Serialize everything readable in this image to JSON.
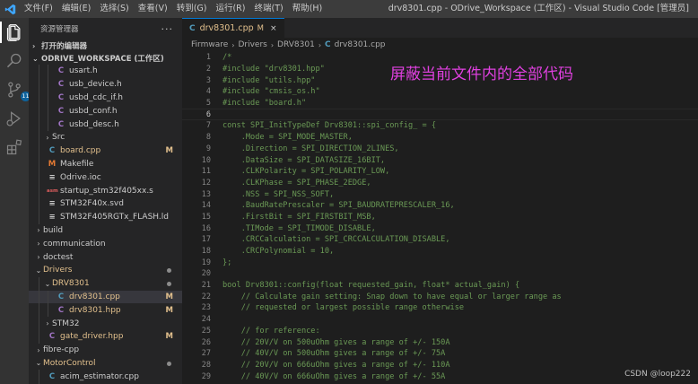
{
  "titlebar": {
    "menus": [
      "文件(F)",
      "编辑(E)",
      "选择(S)",
      "查看(V)",
      "转到(G)",
      "运行(R)",
      "终端(T)",
      "帮助(H)"
    ],
    "window_title": "drv8301.cpp - ODrive_Workspace (工作区) - Visual Studio Code [管理员]"
  },
  "activity": {
    "scm_badge": "11"
  },
  "sidebar": {
    "title": "资源管理器",
    "more": "···",
    "open_editors": "打开的编辑器",
    "workspace": "ODRIVE_WORKSPACE (工作区)",
    "items": [
      {
        "label": "usart.h",
        "icon": "C",
        "type": "h",
        "depth": 2
      },
      {
        "label": "usb_device.h",
        "icon": "C",
        "type": "h",
        "depth": 2
      },
      {
        "label": "usbd_cdc_if.h",
        "icon": "C",
        "type": "h",
        "depth": 2
      },
      {
        "label": "usbd_conf.h",
        "icon": "C",
        "type": "h",
        "depth": 2
      },
      {
        "label": "usbd_desc.h",
        "icon": "C",
        "type": "h",
        "depth": 2
      },
      {
        "label": "Src",
        "folder": true,
        "depth": 1
      },
      {
        "label": "board.cpp",
        "icon": "C",
        "type": "cpp",
        "depth": 1,
        "status": "M"
      },
      {
        "label": "Makefile",
        "icon": "M",
        "type": "make",
        "depth": 1
      },
      {
        "label": "Odrive.ioc",
        "icon": "≡",
        "type": "txt",
        "depth": 1
      },
      {
        "label": "startup_stm32f405xx.s",
        "icon": "asm",
        "type": "asm",
        "depth": 1
      },
      {
        "label": "STM32F40x.svd",
        "icon": "≡",
        "type": "txt",
        "depth": 1
      },
      {
        "label": "STM32F405RGTx_FLASH.ld",
        "icon": "≡",
        "type": "txt",
        "depth": 1
      },
      {
        "label": "build",
        "folder": true,
        "depth": 0
      },
      {
        "label": "communication",
        "folder": true,
        "depth": 0
      },
      {
        "label": "doctest",
        "folder": true,
        "depth": 0
      },
      {
        "label": "Drivers",
        "folder": true,
        "open": true,
        "depth": 0,
        "dot": true
      },
      {
        "label": "DRV8301",
        "folder": true,
        "open": true,
        "depth": 1,
        "dot": true
      },
      {
        "label": "drv8301.cpp",
        "icon": "C",
        "type": "cpp",
        "depth": 2,
        "status": "M",
        "selected": true
      },
      {
        "label": "drv8301.hpp",
        "icon": "C",
        "type": "h",
        "depth": 2,
        "status": "M"
      },
      {
        "label": "STM32",
        "folder": true,
        "depth": 1
      },
      {
        "label": "gate_driver.hpp",
        "icon": "C",
        "type": "h",
        "depth": 1,
        "status": "M"
      },
      {
        "label": "fibre-cpp",
        "folder": true,
        "depth": 0
      },
      {
        "label": "MotorControl",
        "folder": true,
        "open": true,
        "depth": 0,
        "dot": true
      },
      {
        "label": "acim_estimator.cpp",
        "icon": "C",
        "type": "cpp",
        "depth": 1
      },
      {
        "label": "acim_estimator.hpp",
        "icon": "C",
        "type": "h",
        "depth": 1
      }
    ]
  },
  "editor": {
    "tab": {
      "label": "drv8301.cpp",
      "modified": "M",
      "close": "×",
      "icon": "C"
    },
    "breadcrumb": [
      "Firmware",
      "Drivers",
      "DRV8301",
      "drv8301.cpp"
    ],
    "active_line": 6,
    "lines": [
      {
        "n": 1,
        "text": "/*"
      },
      {
        "n": 2,
        "text": "#include \"drv8301.hpp\""
      },
      {
        "n": 3,
        "text": "#include \"utils.hpp\""
      },
      {
        "n": 4,
        "text": "#include \"cmsis_os.h\""
      },
      {
        "n": 5,
        "text": "#include \"board.h\""
      },
      {
        "n": 6,
        "text": ""
      },
      {
        "n": 7,
        "text": "const SPI_InitTypeDef Drv8301::spi_config_ = {"
      },
      {
        "n": 8,
        "text": "    .Mode = SPI_MODE_MASTER,"
      },
      {
        "n": 9,
        "text": "    .Direction = SPI_DIRECTION_2LINES,"
      },
      {
        "n": 10,
        "text": "    .DataSize = SPI_DATASIZE_16BIT,"
      },
      {
        "n": 11,
        "text": "    .CLKPolarity = SPI_POLARITY_LOW,"
      },
      {
        "n": 12,
        "text": "    .CLKPhase = SPI_PHASE_2EDGE,"
      },
      {
        "n": 13,
        "text": "    .NSS = SPI_NSS_SOFT,"
      },
      {
        "n": 14,
        "text": "    .BaudRatePrescaler = SPI_BAUDRATEPRESCALER_16,"
      },
      {
        "n": 15,
        "text": "    .FirstBit = SPI_FIRSTBIT_MSB,"
      },
      {
        "n": 16,
        "text": "    .TIMode = SPI_TIMODE_DISABLE,"
      },
      {
        "n": 17,
        "text": "    .CRCCalculation = SPI_CRCCALCULATION_DISABLE,"
      },
      {
        "n": 18,
        "text": "    .CRCPolynomial = 10,"
      },
      {
        "n": 19,
        "text": "};"
      },
      {
        "n": 20,
        "text": ""
      },
      {
        "n": 21,
        "text": "bool Drv8301::config(float requested_gain, float* actual_gain) {"
      },
      {
        "n": 22,
        "text": "    // Calculate gain setting: Snap down to have equal or larger range as"
      },
      {
        "n": 23,
        "text": "    // requested or largest possible range otherwise"
      },
      {
        "n": 24,
        "text": ""
      },
      {
        "n": 25,
        "text": "    // for reference:"
      },
      {
        "n": 26,
        "text": "    // 20V/V on 500uOhm gives a range of +/- 150A"
      },
      {
        "n": 27,
        "text": "    // 40V/V on 500uOhm gives a range of +/- 75A"
      },
      {
        "n": 28,
        "text": "    // 20V/V on 666uOhm gives a range of +/- 110A"
      },
      {
        "n": 29,
        "text": "    // 40V/V on 666uOhm gives a range of +/- 55A"
      }
    ]
  },
  "annotation": "屏蔽当前文件内的全部代码",
  "watermark": "CSDN @loop222",
  "colors": {
    "comment_green": "#6a9955",
    "modified": "#e2c08d",
    "annotation": "#e040e0",
    "accent": "#0078d4"
  }
}
